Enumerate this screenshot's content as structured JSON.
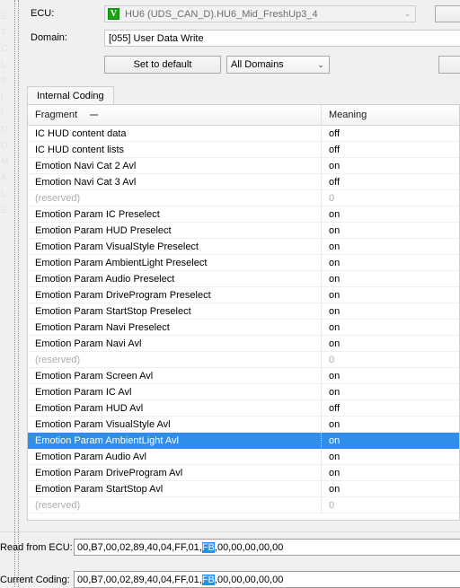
{
  "window": {
    "background_color": "#f0f0f0",
    "accent_color": "#2f8eea"
  },
  "left_strip": {
    "ghost_fragments": [
      "E",
      "T",
      "C",
      "L",
      "S",
      "I",
      "I",
      "O",
      "O",
      "M",
      "A",
      "L",
      "E"
    ]
  },
  "form": {
    "ecu_label": "ECU:",
    "ecu_value": "HU6 (UDS_CAN_D).HU6_Mid_FreshUp3_4",
    "ecu_icon_glyph": "V",
    "ecu_icon_name": "vector-green-icon",
    "ecu_dropdown_arrow": "⌄",
    "domain_label": "Domain:",
    "domain_value": "[055] User Data Write",
    "set_to_default_label": "Set to default",
    "all_domains_value": "All Domains",
    "all_domains_arrow": "⌄"
  },
  "tabs": [
    {
      "label": "Internal Coding",
      "active": true
    }
  ],
  "table": {
    "columns": [
      "Fragment",
      "Meaning"
    ],
    "sort_indicator": "minus-icon",
    "rows": [
      {
        "fragment": "IC HUD content data",
        "meaning": "off",
        "reserved": false,
        "selected": false
      },
      {
        "fragment": "IC HUD content lists",
        "meaning": "off",
        "reserved": false,
        "selected": false
      },
      {
        "fragment": "Emotion Navi Cat 2 Avl",
        "meaning": "on",
        "reserved": false,
        "selected": false
      },
      {
        "fragment": "Emotion Navi Cat 3 Avl",
        "meaning": "off",
        "reserved": false,
        "selected": false
      },
      {
        "fragment": "(reserved)",
        "meaning": "0",
        "reserved": true,
        "selected": false
      },
      {
        "fragment": "Emotion Param IC Preselect",
        "meaning": "on",
        "reserved": false,
        "selected": false
      },
      {
        "fragment": "Emotion Param HUD Preselect",
        "meaning": "on",
        "reserved": false,
        "selected": false
      },
      {
        "fragment": "Emotion Param VisualStyle Preselect",
        "meaning": "on",
        "reserved": false,
        "selected": false
      },
      {
        "fragment": "Emotion Param AmbientLight Preselect",
        "meaning": "on",
        "reserved": false,
        "selected": false
      },
      {
        "fragment": "Emotion Param Audio Preselect",
        "meaning": "on",
        "reserved": false,
        "selected": false
      },
      {
        "fragment": "Emotion Param DriveProgram Preselect",
        "meaning": "on",
        "reserved": false,
        "selected": false
      },
      {
        "fragment": "Emotion Param StartStop Preselect",
        "meaning": "on",
        "reserved": false,
        "selected": false
      },
      {
        "fragment": "Emotion Param Navi Preselect",
        "meaning": "on",
        "reserved": false,
        "selected": false
      },
      {
        "fragment": "Emotion Param Navi Avl",
        "meaning": "on",
        "reserved": false,
        "selected": false
      },
      {
        "fragment": "(reserved)",
        "meaning": "0",
        "reserved": true,
        "selected": false
      },
      {
        "fragment": "Emotion Param Screen Avl",
        "meaning": "on",
        "reserved": false,
        "selected": false
      },
      {
        "fragment": "Emotion Param IC Avl",
        "meaning": "on",
        "reserved": false,
        "selected": false
      },
      {
        "fragment": "Emotion Param HUD Avl",
        "meaning": "off",
        "reserved": false,
        "selected": false
      },
      {
        "fragment": "Emotion Param VisualStyle Avl",
        "meaning": "on",
        "reserved": false,
        "selected": false
      },
      {
        "fragment": "Emotion Param AmbientLight Avl",
        "meaning": "on",
        "reserved": false,
        "selected": true
      },
      {
        "fragment": "Emotion Param Audio Avl",
        "meaning": "on",
        "reserved": false,
        "selected": false
      },
      {
        "fragment": "Emotion Param DriveProgram Avl",
        "meaning": "on",
        "reserved": false,
        "selected": false
      },
      {
        "fragment": "Emotion Param StartStop Avl",
        "meaning": "on",
        "reserved": false,
        "selected": false
      },
      {
        "fragment": "(reserved)",
        "meaning": "0",
        "reserved": true,
        "selected": false
      }
    ]
  },
  "bottom": {
    "read_from_ecu_label": "Read from ECU:",
    "current_coding_label": "Current Coding:",
    "read_from_ecu_prefix": "00,B7,00,02,89,40,04,FF,01,",
    "read_from_ecu_selected": "FB",
    "read_from_ecu_suffix": ",00,00,00,00,00",
    "current_coding_prefix": "00,B7,00,02,89,40,04,FF,01,",
    "current_coding_selected": "FB",
    "current_coding_suffix": ",00,00,00,00,00"
  }
}
